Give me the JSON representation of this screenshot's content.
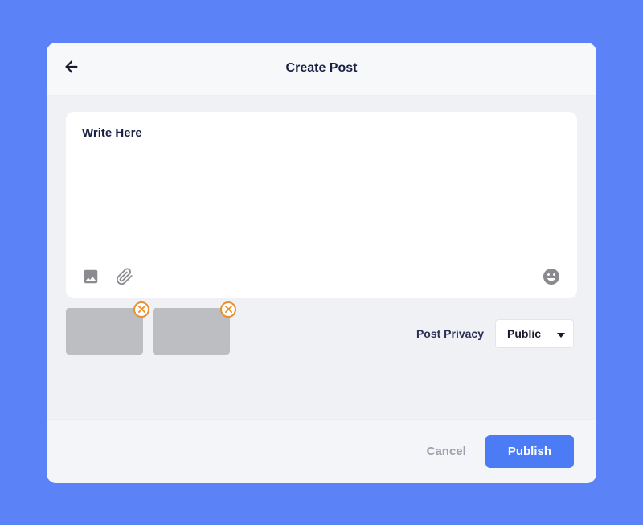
{
  "header": {
    "title": "Create Post"
  },
  "composer": {
    "placeholder": "Write Here"
  },
  "attachments": [
    {
      "id": 1
    },
    {
      "id": 2
    }
  ],
  "privacy": {
    "label": "Post Privacy",
    "selected": "Public"
  },
  "actions": {
    "cancel": "Cancel",
    "publish": "Publish"
  }
}
